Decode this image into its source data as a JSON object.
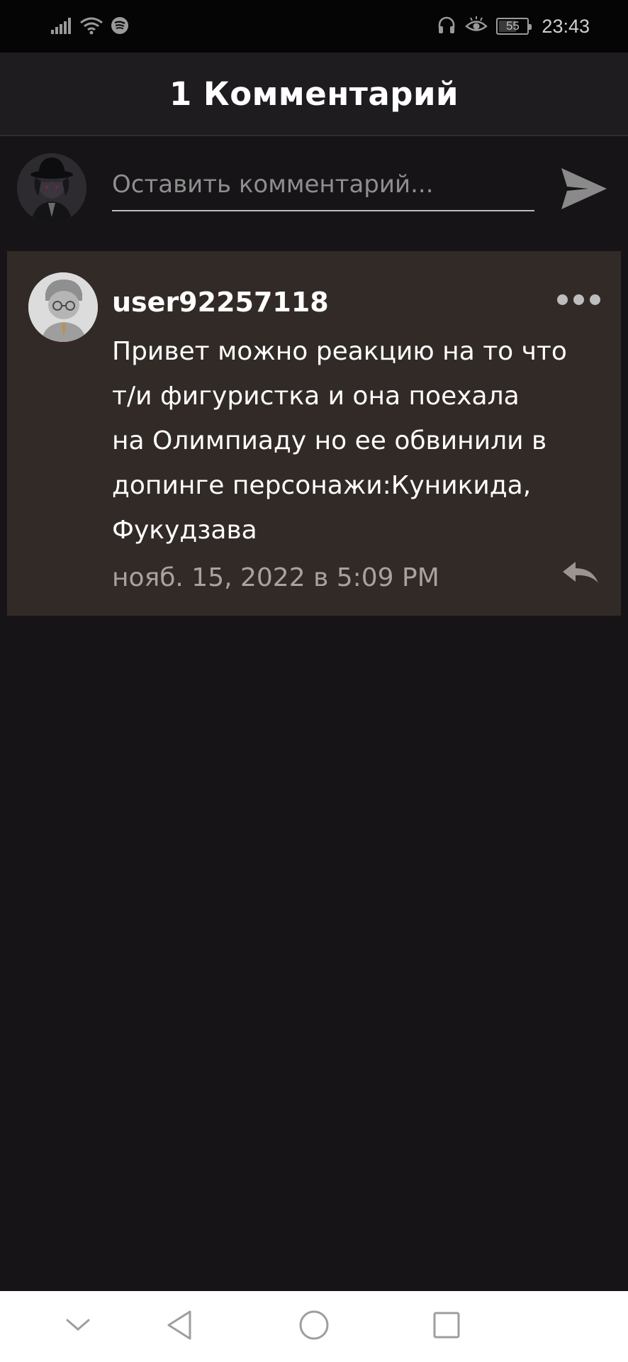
{
  "status_bar": {
    "time": "23:43",
    "battery_level": "55",
    "icons": [
      "signal-icon",
      "wifi-icon",
      "spotify-icon",
      "headphones-icon",
      "eye-comfort-icon",
      "battery-icon"
    ]
  },
  "header": {
    "title": "1 Комментарий"
  },
  "compose": {
    "placeholder": "Оставить комментарий...",
    "value": "",
    "send_icon": "send-icon"
  },
  "comments": [
    {
      "username": "user92257118",
      "text": "Привет можно реакцию на то что\nт/и фигуристка и она поехала\nна Олимпиаду но ее обвинили в\nдопинге персонажи:Куникида,\nФукудзава",
      "date": "нояб. 15, 2022 в 5:09 PM",
      "more_icon": "more-dots-icon",
      "reply_icon": "reply-icon"
    }
  ],
  "nav_bar": {
    "icons": [
      "chevron-down-icon",
      "back-icon",
      "home-icon",
      "recents-icon"
    ]
  },
  "colors": {
    "background": "#161417",
    "header_bg": "#1e1c1f",
    "card_bg": "#322a26",
    "muted_text": "#a8a3a0"
  }
}
